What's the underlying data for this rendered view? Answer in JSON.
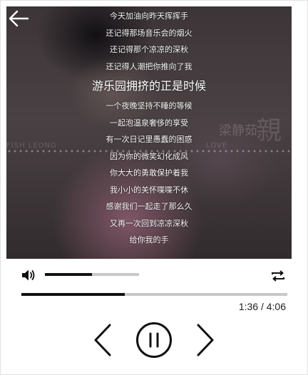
{
  "player": {
    "lyrics": [
      {
        "text": "今天加油向昨天挥挥手",
        "current": false
      },
      {
        "text": "还记得那场音乐会的烟火",
        "current": false
      },
      {
        "text": "还记得那个凉凉的深秋",
        "current": false
      },
      {
        "text": "还记得人潮把你推向了我",
        "current": false
      },
      {
        "text": "游乐园拥挤的正是时候",
        "current": true
      },
      {
        "text": "一个夜晚坚持不睡的等候",
        "current": false
      },
      {
        "text": "一起泡温泉奢侈的享受",
        "current": false
      },
      {
        "text": "有一次日记里愚蠢的困惑",
        "current": false
      },
      {
        "text": "因为你的微笑幻化成风",
        "current": false
      },
      {
        "text": "你大大的勇敢保护着我",
        "current": false
      },
      {
        "text": "我小小的关怀喋喋不休",
        "current": false
      },
      {
        "text": "感谢我们一起走了那么久",
        "current": false
      },
      {
        "text": "又再一次回到凉凉深秋",
        "current": false
      },
      {
        "text": "给你我的手",
        "current": false
      }
    ],
    "watermark": {
      "artist_cn": "梁静茹",
      "title_cn": "親",
      "artist_en": "FISH LEONG",
      "title_en": "LOVE"
    },
    "volume": 0.5,
    "progress": 0.39,
    "time_display": "1:36 / 4:06",
    "icons": {
      "back": "arrow-left-icon",
      "volume": "speaker-icon",
      "repeat": "repeat-icon",
      "prev": "chevron-left-icon",
      "pause": "pause-circle-icon",
      "next": "chevron-right-icon"
    },
    "colors": {
      "accent": "#111111",
      "track": "#c8c8c8",
      "lyric_text": "#f3f3f3"
    }
  }
}
